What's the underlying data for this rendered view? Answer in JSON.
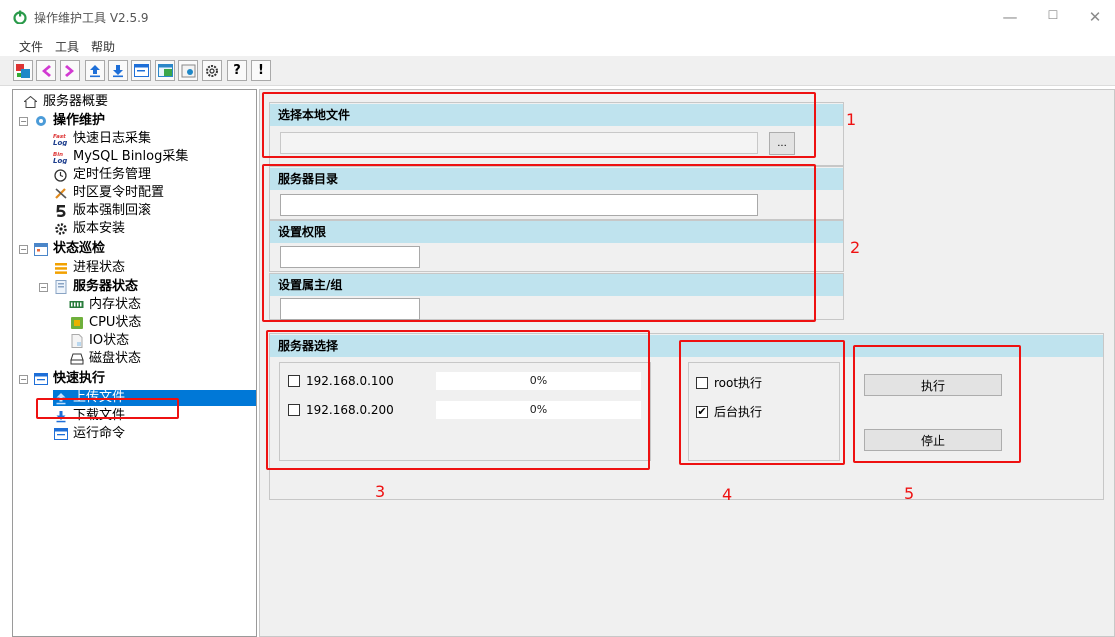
{
  "app": {
    "title": "操作维护工具 V2.5.9"
  },
  "window_controls": {
    "minimize": "—",
    "maximize": "☐",
    "close": "✕"
  },
  "menu": [
    "文件",
    "工具",
    "帮助"
  ],
  "toolbar": [
    "server-tree",
    "back",
    "forward",
    "upload",
    "download",
    "terminal",
    "image",
    "settings",
    "?",
    "!"
  ],
  "toolbar_glyphs": {
    "help": "?",
    "exclaim": "!"
  },
  "tree": {
    "server_overview": "服务器概要",
    "ops": "操作维护",
    "fast_log": "快速日志采集",
    "mysql_binlog": "MySQL Binlog采集",
    "scheduled_task": "定时任务管理",
    "timezone": "时区夏令时配置",
    "rollback": "版本强制回滚",
    "install": "版本安装",
    "inspection": "状态巡检",
    "process_status": "进程状态",
    "server_status": "服务器状态",
    "memory_status": "内存状态",
    "cpu_status": "CPU状态",
    "io_status": "IO状态",
    "disk_status": "磁盘状态",
    "quick_exec": "快速执行",
    "upload_file": "上传文件",
    "download_file": "下载文件",
    "run_command": "运行命令"
  },
  "sections": {
    "local_file": {
      "title": "选择本地文件",
      "value": "",
      "browse": "..."
    },
    "server_dir": {
      "title": "服务器目录",
      "value": ""
    },
    "permission": {
      "title": "设置权限",
      "value": ""
    },
    "owner": {
      "title": "设置属主/组",
      "value": ""
    },
    "server_select": {
      "title": "服务器选择",
      "servers": [
        {
          "ip": "192.168.0.100",
          "progress": "0%",
          "checked": false
        },
        {
          "ip": "192.168.0.200",
          "progress": "0%",
          "checked": false
        }
      ]
    },
    "options": {
      "root_exec": {
        "label": "root执行",
        "checked": false
      },
      "background_exec": {
        "label": "后台执行",
        "checked": true
      }
    },
    "actions": {
      "execute": "执行",
      "stop": "停止"
    }
  },
  "annotations": [
    "1",
    "2",
    "3",
    "4",
    "5"
  ],
  "colors": {
    "header_bg": "#bfe3ee",
    "selection": "#0078d7",
    "annotation": "#ee1111"
  },
  "checkmark": "✔",
  "expander_minus": "−"
}
